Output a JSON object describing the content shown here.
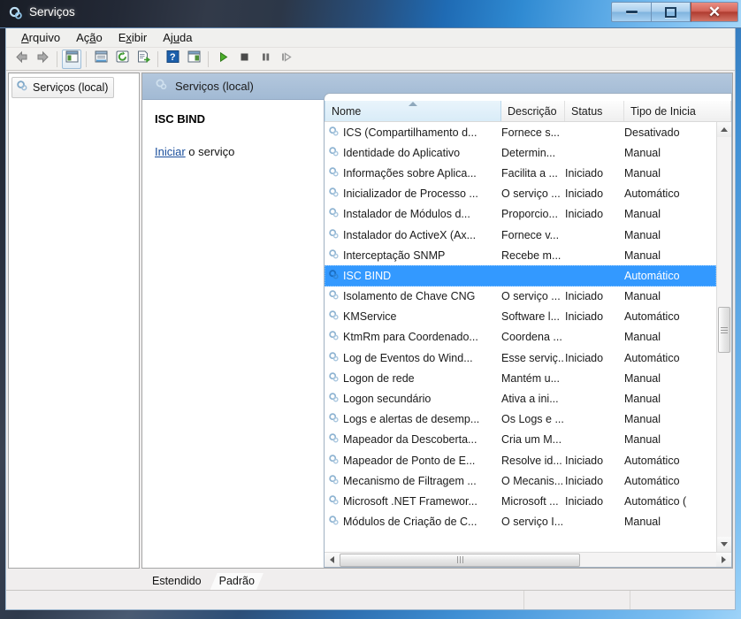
{
  "window": {
    "title": "Serviços",
    "icon": "services-gear-icon",
    "controls": {
      "minimize": "Minimizar",
      "maximize": "Restaurar",
      "close": "Fechar"
    }
  },
  "menubar": [
    {
      "label": "Arquivo",
      "accel": "A",
      "name": "menu-arquivo"
    },
    {
      "label": "Ação",
      "accel": "o",
      "name": "menu-acao"
    },
    {
      "label": "Exibir",
      "accel": "x",
      "name": "menu-exibir"
    },
    {
      "label": "Ajuda",
      "accel": "u",
      "name": "menu-ajuda"
    }
  ],
  "toolbar": [
    {
      "name": "back-button",
      "icon": "left-arrow-icon"
    },
    {
      "name": "forward-button",
      "icon": "right-arrow-icon"
    },
    {
      "name": "show-hide-tree-button",
      "icon": "tree-pane-icon",
      "pressed": true
    },
    {
      "name": "properties-button",
      "icon": "properties-icon"
    },
    {
      "name": "refresh-button",
      "icon": "refresh-icon"
    },
    {
      "name": "export-list-button",
      "icon": "export-list-icon"
    },
    {
      "name": "help-button",
      "icon": "question-mark-icon"
    },
    {
      "name": "show-action-pane-button",
      "icon": "action-pane-icon"
    },
    {
      "name": "start-service-button",
      "icon": "play-icon"
    },
    {
      "name": "stop-service-button",
      "icon": "stop-icon"
    },
    {
      "name": "pause-service-button",
      "icon": "pause-icon"
    },
    {
      "name": "restart-service-button",
      "icon": "restart-icon"
    }
  ],
  "tree": {
    "root_label": "Serviços (local)",
    "icon": "services-gear-icon"
  },
  "right_pane": {
    "header": "Serviços (local)",
    "header_icon": "services-gear-icon"
  },
  "details": {
    "service_name": "ISC BIND",
    "action_link": "Iniciar",
    "action_suffix": " o serviço"
  },
  "list": {
    "columns": [
      {
        "key": "name",
        "label": "Nome",
        "sorted": true,
        "sort_dir": "asc"
      },
      {
        "key": "description",
        "label": "Descrição",
        "sorted": false
      },
      {
        "key": "status",
        "label": "Status",
        "sorted": false
      },
      {
        "key": "startup",
        "label": "Tipo de Inicia",
        "sorted": false
      }
    ],
    "rows": [
      {
        "name": "ICS (Compartilhamento d...",
        "description": "Fornece s...",
        "status": "",
        "startup": "Desativado",
        "selected": false
      },
      {
        "name": "Identidade do Aplicativo",
        "description": "Determin...",
        "status": "",
        "startup": "Manual",
        "selected": false
      },
      {
        "name": "Informações sobre Aplica...",
        "description": "Facilita a ...",
        "status": "Iniciado",
        "startup": "Manual",
        "selected": false
      },
      {
        "name": "Inicializador de Processo ...",
        "description": "O serviço ...",
        "status": "Iniciado",
        "startup": "Automático",
        "selected": false
      },
      {
        "name": "Instalador de Módulos d...",
        "description": "Proporcio...",
        "status": "Iniciado",
        "startup": "Manual",
        "selected": false
      },
      {
        "name": "Instalador do ActiveX (Ax...",
        "description": "Fornece v...",
        "status": "",
        "startup": "Manual",
        "selected": false
      },
      {
        "name": "Interceptação SNMP",
        "description": "Recebe m...",
        "status": "",
        "startup": "Manual",
        "selected": false
      },
      {
        "name": "ISC BIND",
        "description": "",
        "status": "",
        "startup": "Automático",
        "selected": true
      },
      {
        "name": "Isolamento de Chave CNG",
        "description": "O serviço ...",
        "status": "Iniciado",
        "startup": "Manual",
        "selected": false
      },
      {
        "name": "KMService",
        "description": "Software l...",
        "status": "Iniciado",
        "startup": "Automático",
        "selected": false
      },
      {
        "name": "KtmRm para Coordenado...",
        "description": "Coordena ...",
        "status": "",
        "startup": "Manual",
        "selected": false
      },
      {
        "name": "Log de Eventos do Wind...",
        "description": "Esse serviç...",
        "status": "Iniciado",
        "startup": "Automático",
        "selected": false
      },
      {
        "name": "Logon de rede",
        "description": "Mantém u...",
        "status": "",
        "startup": "Manual",
        "selected": false
      },
      {
        "name": "Logon secundário",
        "description": "Ativa a ini...",
        "status": "",
        "startup": "Manual",
        "selected": false
      },
      {
        "name": "Logs e alertas de desemp...",
        "description": "Os Logs e ...",
        "status": "",
        "startup": "Manual",
        "selected": false
      },
      {
        "name": "Mapeador da Descoberta...",
        "description": "Cria um M...",
        "status": "",
        "startup": "Manual",
        "selected": false
      },
      {
        "name": "Mapeador de Ponto de E...",
        "description": "Resolve id...",
        "status": "Iniciado",
        "startup": "Automático",
        "selected": false
      },
      {
        "name": "Mecanismo de Filtragem ...",
        "description": "O Mecanis...",
        "status": "Iniciado",
        "startup": "Automático",
        "selected": false
      },
      {
        "name": "Microsoft .NET Framewor...",
        "description": "Microsoft ...",
        "status": "Iniciado",
        "startup": "Automático (",
        "selected": false
      },
      {
        "name": "Módulos de Criação de C...",
        "description": "O serviço I...",
        "status": "",
        "startup": "Manual",
        "selected": false
      }
    ]
  },
  "tabs": [
    {
      "label": "Estendido",
      "active": false,
      "name": "tab-estendido"
    },
    {
      "label": "Padrão",
      "active": true,
      "name": "tab-padrao"
    }
  ],
  "statusbar": {
    "panel1": "",
    "panel2": "",
    "panel3": ""
  },
  "colors": {
    "selection": "#3399ff",
    "header_pane": "#a2bad4",
    "link": "#1b4f9c",
    "close_button": "#b03c30"
  }
}
